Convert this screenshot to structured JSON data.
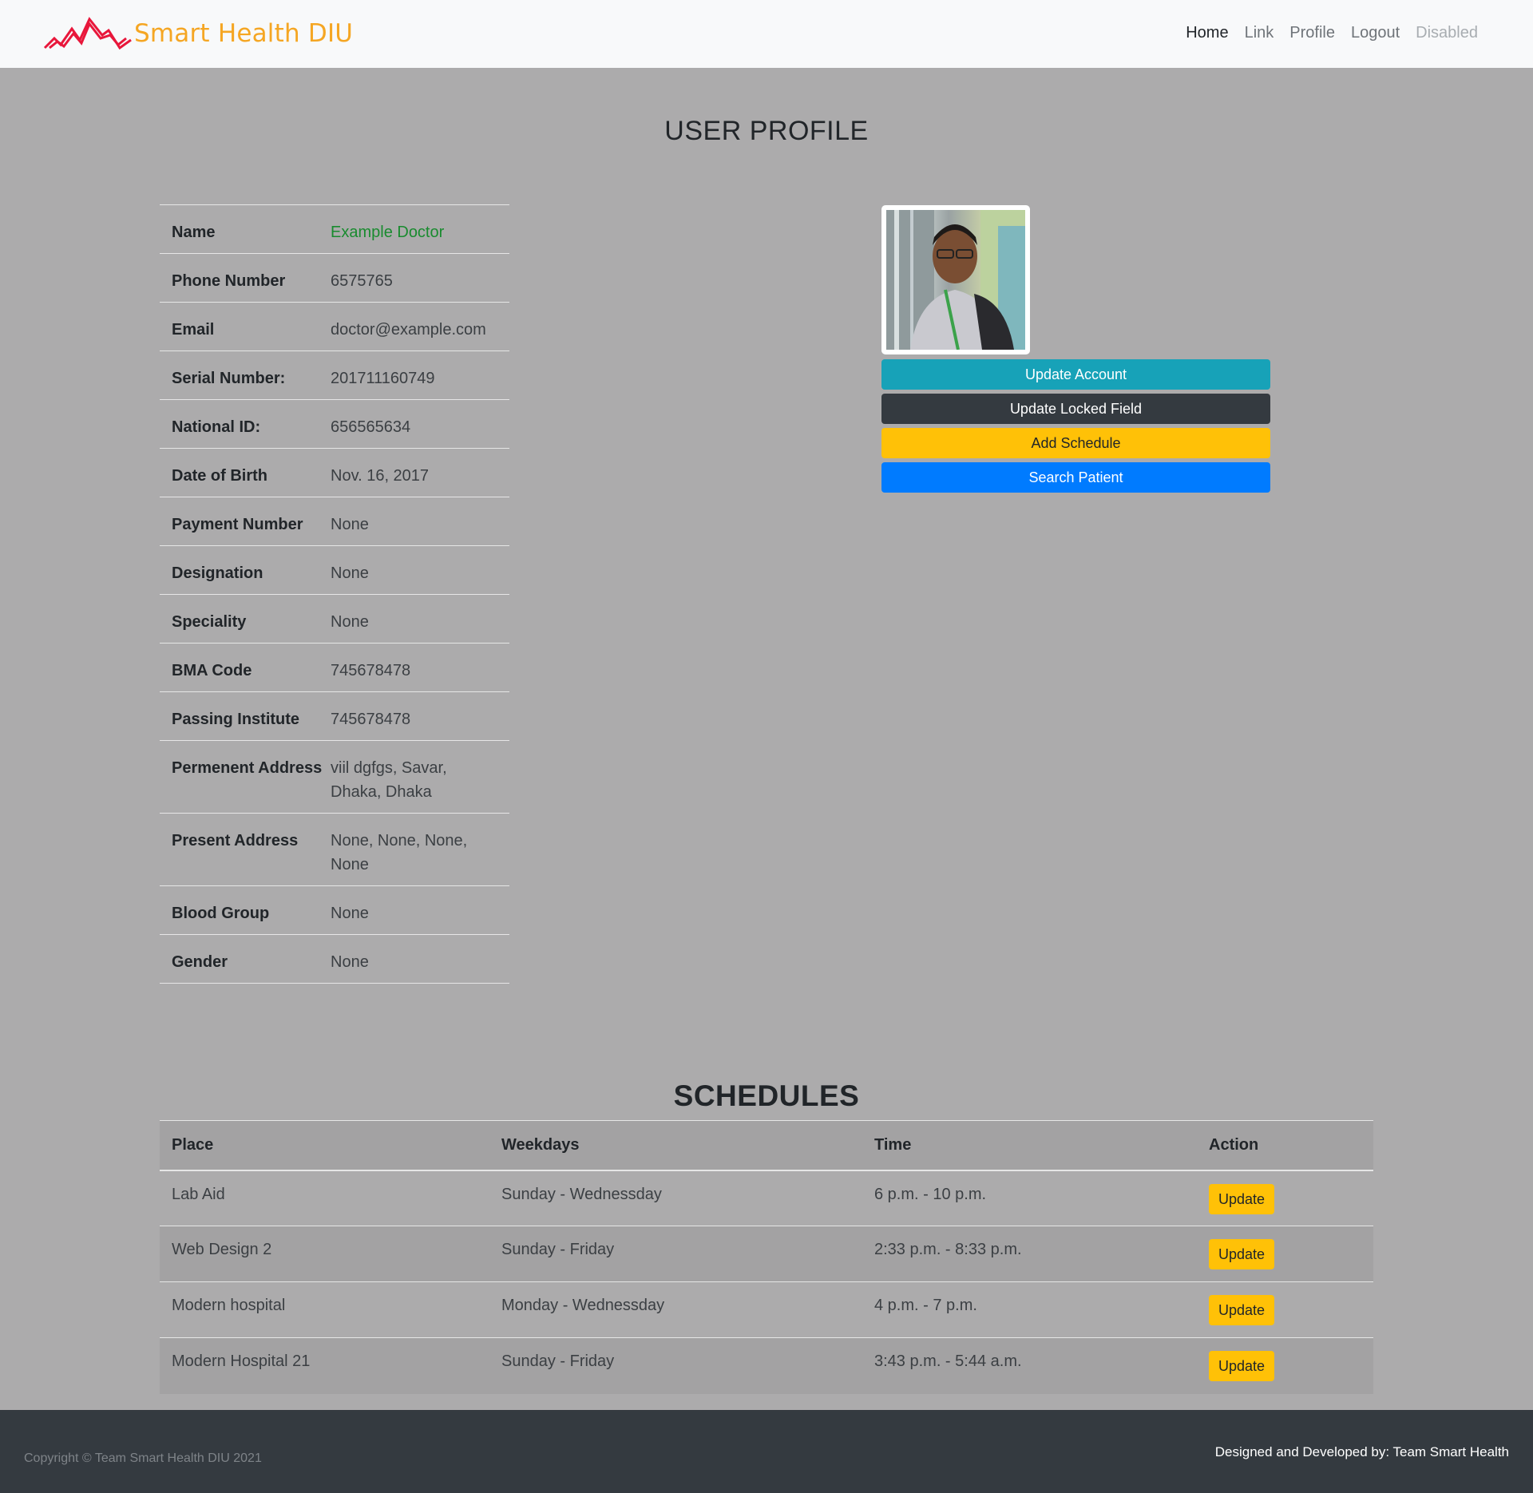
{
  "brand": {
    "name": "Smart Health DIU",
    "logo_icon": "heartbeat-lines-icon",
    "logo_color": "#e8173b",
    "text_color": "#f5a623"
  },
  "nav": {
    "items": [
      "Home",
      "Link",
      "Profile",
      "Logout",
      "Disabled"
    ],
    "active": "Home",
    "disabled": "Disabled"
  },
  "profile": {
    "title": "USER PROFILE",
    "rows": [
      {
        "label": "Name",
        "value": "Example Doctor"
      },
      {
        "label": "Phone Number",
        "value": "6575765"
      },
      {
        "label": "Email",
        "value": "doctor@example.com"
      },
      {
        "label": "Serial Number:",
        "value": "201711160749"
      },
      {
        "label": "National ID:",
        "value": "656565634"
      },
      {
        "label": "Date of Birth",
        "value": "Nov. 16, 2017"
      },
      {
        "label": "Payment Number",
        "value": "None"
      },
      {
        "label": "Designation",
        "value": "None"
      },
      {
        "label": "Speciality",
        "value": "None"
      },
      {
        "label": "BMA Code",
        "value": "745678478"
      },
      {
        "label": "Passing Institute",
        "value": "745678478"
      },
      {
        "label": "Permenent Address",
        "value": "viil dgfgs, Savar, Dhaka, Dhaka"
      },
      {
        "label": "Present Address",
        "value": "None, None, None, None"
      },
      {
        "label": "Blood Group",
        "value": "None"
      },
      {
        "label": "Gender",
        "value": "None"
      }
    ],
    "buttons": {
      "update_account": "Update Account",
      "update_locked": "Update Locked Field",
      "add_schedule": "Add Schedule",
      "search_patient": "Search Patient"
    }
  },
  "schedules": {
    "title": "SCHEDULES",
    "columns": [
      "Place",
      "Weekdays",
      "Time",
      "Action"
    ],
    "rows": [
      {
        "place": "Lab Aid",
        "weekdays": "Sunday - Wednessday",
        "time": "6 p.m. - 10 p.m.",
        "action": "Update"
      },
      {
        "place": "Web Design 2",
        "weekdays": "Sunday - Friday",
        "time": "2:33 p.m. - 8:33 p.m.",
        "action": "Update"
      },
      {
        "place": "Modern hospital",
        "weekdays": "Monday - Wednessday",
        "time": "4 p.m. - 7 p.m.",
        "action": "Update"
      },
      {
        "place": "Modern Hospital 21",
        "weekdays": "Sunday - Friday",
        "time": "3:43 p.m. - 5:44 a.m.",
        "action": "Update"
      }
    ]
  },
  "footer": {
    "copyright": "Copyright © Team Smart Health DIU 2021",
    "developed_by": "Designed and Developed by: Team Smart Health"
  }
}
